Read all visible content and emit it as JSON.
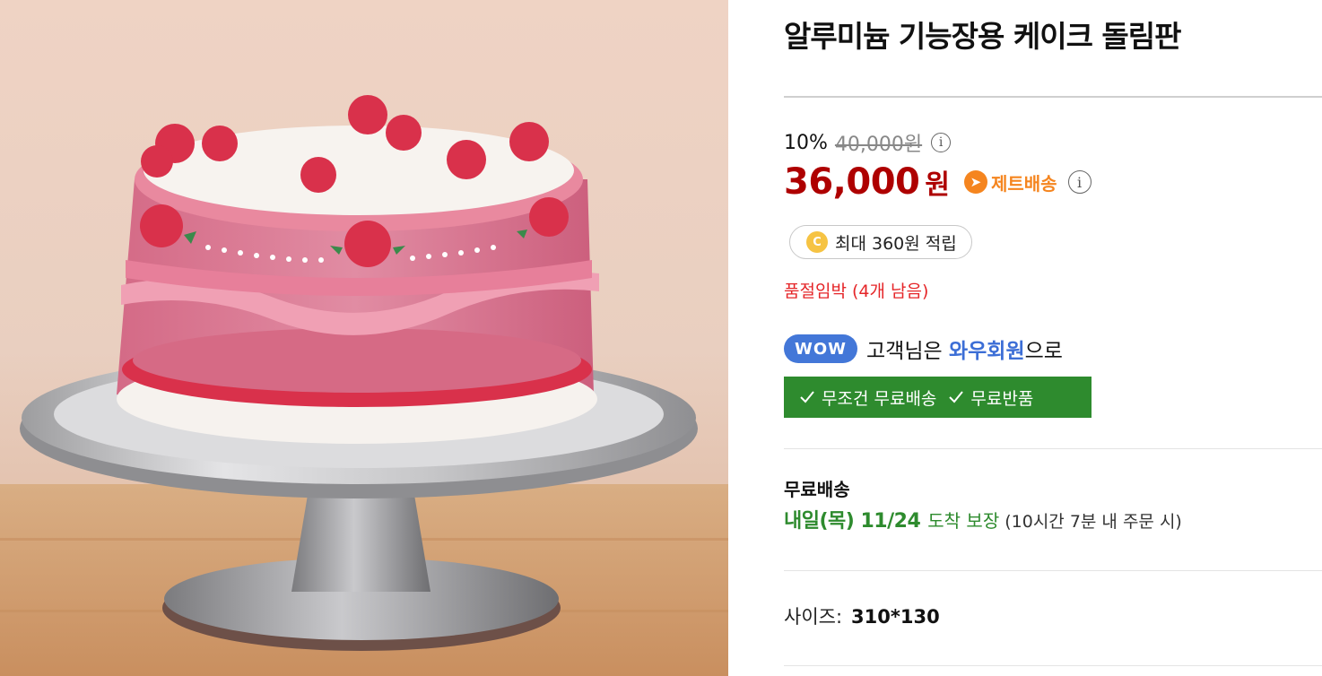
{
  "product": {
    "title": "알루미늄 기능장용 케이크 돌림판",
    "image_alt": "cake-turntable-photo"
  },
  "pricing": {
    "discount_rate": "10%",
    "original_price": "40,000원",
    "sale_price": "36,000",
    "price_unit": "원",
    "delivery_badge": "제트배송",
    "info_glyph": "i"
  },
  "reward": {
    "coin_glyph": "C",
    "text": "최대 360원 적립"
  },
  "stock": {
    "warning": "품절임박 (4개 남음)"
  },
  "membership": {
    "badge": "WOW",
    "text_before": "고객님은 ",
    "highlight": "와우회원",
    "text_after": "으로",
    "benefits": [
      "무조건 무료배송",
      "무료반품"
    ]
  },
  "shipping": {
    "label": "무료배송",
    "arrival_date": "내일(목) 11/24",
    "guarantee": "도착 보장",
    "cutoff": "(10시간 7분 내 주문 시)"
  },
  "option": {
    "label": "사이즈:",
    "value": "310*130"
  },
  "colors": {
    "price_red": "#ae0000",
    "jet_orange": "#f5851f",
    "wow_blue": "#4377d8",
    "benefit_green": "#2e8b2e",
    "warning_red": "#e52528"
  }
}
